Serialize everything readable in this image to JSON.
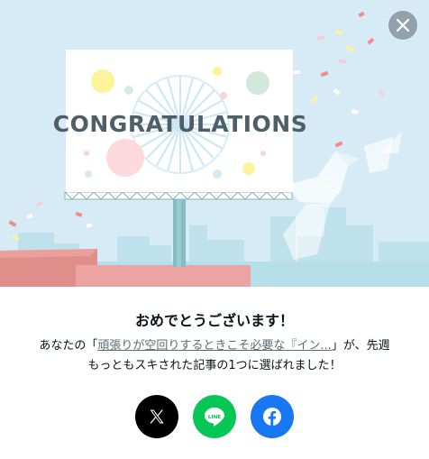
{
  "hero": {
    "billboard_text": "CONGRATULATIONS"
  },
  "dialog": {
    "title": "おめでとうございます！",
    "desc_prefix": "あなたの「",
    "article_link": "頑張りが空回りするときこそ必要な『イン...",
    "desc_suffix": "」が、先週",
    "desc_line2": "もっともスキされた記事の1つに選ばれました！"
  },
  "share": {
    "x_label": "X",
    "line_label": "LINE",
    "facebook_label": "f"
  },
  "icons": [
    "close-icon",
    "x-logo-icon",
    "line-logo-icon",
    "facebook-logo-icon"
  ],
  "colors": {
    "sky": "#d6ebf6",
    "x": "#000000",
    "line": "#06c755",
    "facebook": "#1877f2"
  }
}
